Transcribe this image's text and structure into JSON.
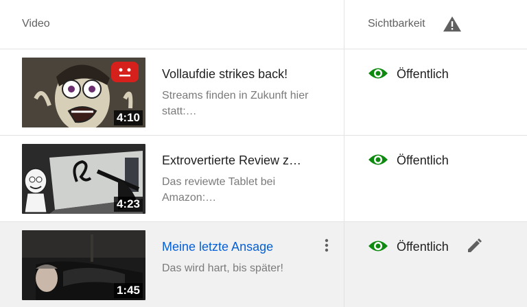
{
  "header": {
    "video_label": "Video",
    "visibility_label": "Sichtbarkeit"
  },
  "videos": [
    {
      "title": "Vollaufdie strikes back!",
      "description": "Streams finden in Zukunft hier statt:…",
      "duration": "4:10",
      "visibility": "Öffentlich",
      "thumbnail_icon": "cartoon-face-thumbnail"
    },
    {
      "title": "Extrovertierte Review z…",
      "description": "Das reviewte Tablet bei Amazon:…",
      "duration": "4:23",
      "visibility": "Öffentlich",
      "thumbnail_icon": "drawing-tablet-thumbnail"
    },
    {
      "title": "Meine letzte Ansage",
      "description": "Das wird hart, bis später!",
      "duration": "1:45",
      "visibility": "Öffentlich",
      "thumbnail_icon": "person-lying-thumbnail"
    }
  ],
  "colors": {
    "visibility_green": "#0f8a10",
    "link_blue": "#065fd4",
    "hover_row": "#f1f1f1"
  }
}
